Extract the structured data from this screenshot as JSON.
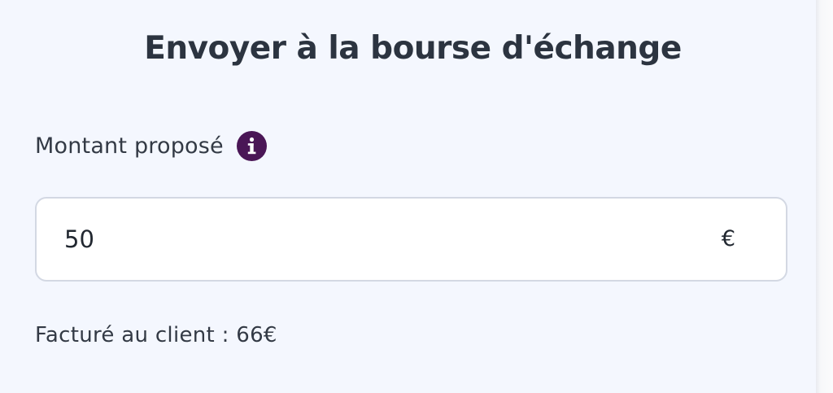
{
  "dialog": {
    "title": "Envoyer à la bourse d'échange"
  },
  "amount": {
    "label": "Montant proposé",
    "info_icon": "info-icon",
    "value": "50",
    "currency_symbol": "€"
  },
  "billing": {
    "text": "Facturé au client : 66€"
  },
  "colors": {
    "panel_background": "#f4f7fe",
    "title_text": "#2c3440",
    "info_icon_background": "#4a1656",
    "field_border": "#d3d8e3"
  }
}
